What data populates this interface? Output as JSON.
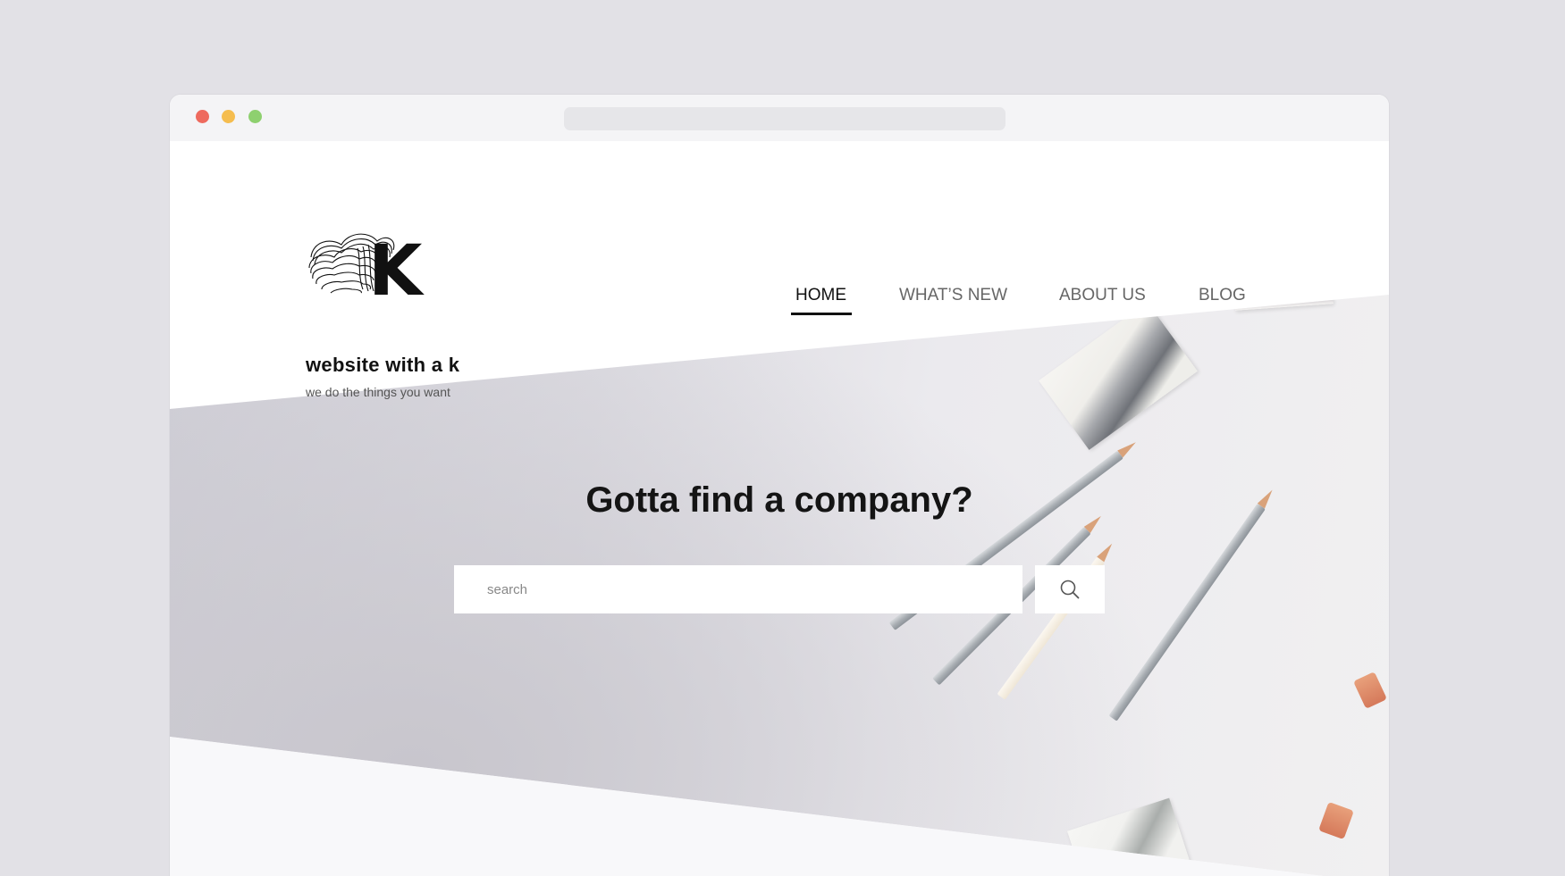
{
  "site": {
    "title": "website with a k",
    "tagline": "we do the things you want",
    "logo_letter": "K"
  },
  "nav": {
    "items": [
      {
        "label": "HOME",
        "active": true
      },
      {
        "label": "WHAT’S NEW",
        "active": false
      },
      {
        "label": "ABOUT US",
        "active": false
      },
      {
        "label": "BLOG",
        "active": false
      }
    ]
  },
  "hero": {
    "headline": "Gotta find a company?",
    "search": {
      "placeholder": "search",
      "value": "",
      "button_icon": "search-icon"
    }
  },
  "window": {
    "controls": [
      "close-dot",
      "minimize-dot",
      "maximize-dot"
    ],
    "address_bar_value": ""
  },
  "colors": {
    "background": "#e2e1e6",
    "text_dark": "#111111",
    "nav_text": "#666666",
    "close": "#ee6a5e",
    "minimize": "#f5bd4f",
    "maximize": "#8ed06f"
  }
}
